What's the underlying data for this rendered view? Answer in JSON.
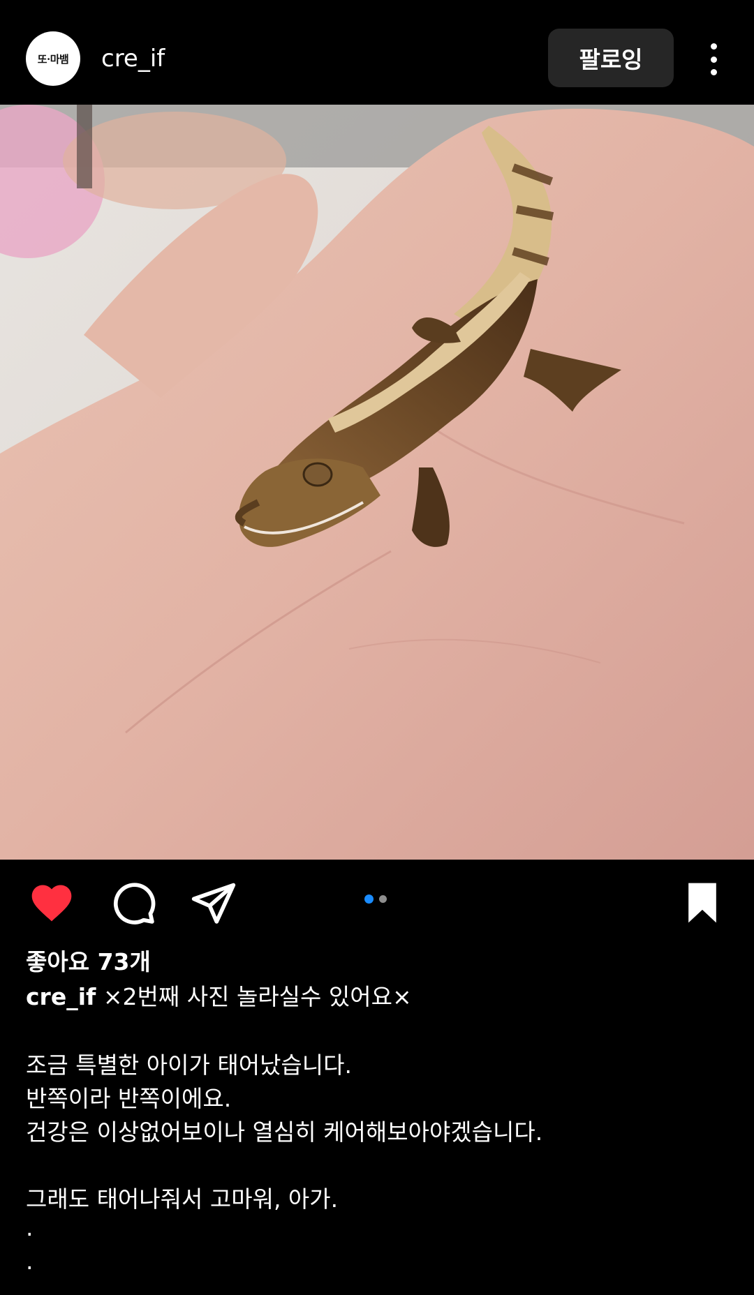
{
  "header": {
    "avatar_text": "또·마뱀",
    "username": "cre_if",
    "follow_label": "팔로잉"
  },
  "post": {
    "likes": "좋아요 73개",
    "caption_user": "cre_if",
    "caption_first": "×2번째 사진 놀라실수 있어요×",
    "lines": [
      "조금 특별한 아이가 태어났습니다.",
      "반쪽이라 반쪽이에요.",
      "건강은 이상없어보이나 열심히 케어해보아야겠습니다.",
      "그래도 태어나줘서 고마워, 아가.",
      ".",
      "."
    ],
    "carousel": {
      "count": 2,
      "active": 1
    }
  },
  "colors": {
    "like_red": "#ff3040",
    "dot_active": "#1a8cff",
    "button_bg": "#262626"
  },
  "icons": [
    "heart-icon",
    "comment-icon",
    "share-icon",
    "bookmark-icon",
    "more-icon"
  ]
}
